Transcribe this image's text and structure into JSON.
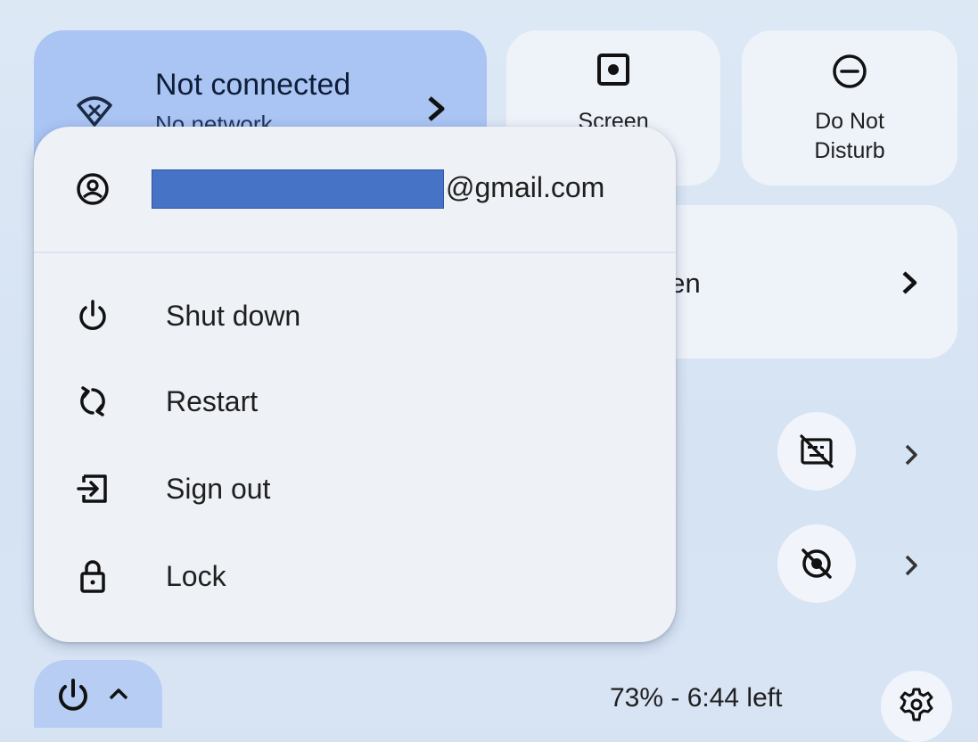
{
  "network_tile": {
    "title": "Not connected",
    "subtitle": "No network",
    "icon": "wifi-off-icon"
  },
  "screen_tile": {
    "label": "Screen",
    "icon": "screen-capture-icon"
  },
  "dnd_tile": {
    "label_line1": "Do Not",
    "label_line2": "Disturb",
    "icon": "do-not-disturb-icon"
  },
  "cast_tile": {
    "label": "st screen",
    "icon": "chevron-right-icon"
  },
  "power_menu": {
    "account_email_suffix": "@gmail.com",
    "account_icon": "account-circle-icon",
    "items": [
      {
        "label": "Shut down",
        "icon": "power-icon"
      },
      {
        "label": "Restart",
        "icon": "restart-icon"
      },
      {
        "label": "Sign out",
        "icon": "sign-out-icon"
      },
      {
        "label": "Lock",
        "icon": "lock-icon"
      }
    ]
  },
  "bottom_bar": {
    "battery_status": "73% - 6:44 left",
    "power_button_icon": "power-icon",
    "settings_icon": "gear-icon"
  },
  "colors": {
    "accent_tile": "#aac4f3",
    "menu_bg": "#eef1f6",
    "redaction": "#4673c6"
  }
}
